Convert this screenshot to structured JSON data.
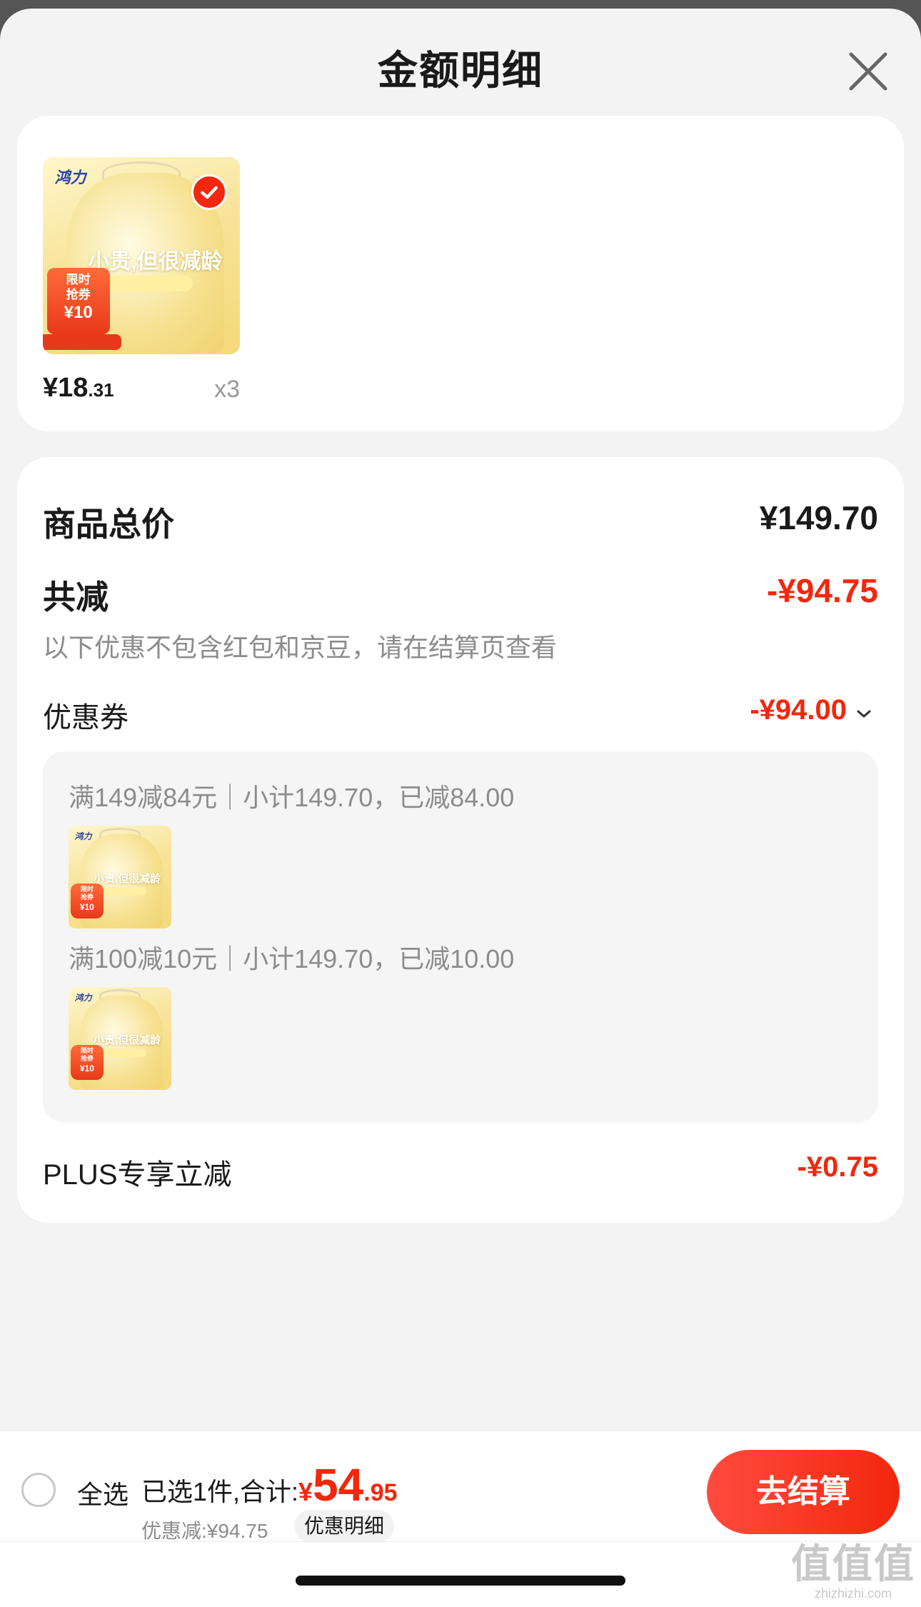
{
  "header": {
    "title": "金额明细"
  },
  "product": {
    "thumb_logo": "鸿力",
    "thumb_slogan": "小贵,但很减龄",
    "thumb_promo_line1": "限时",
    "thumb_promo_line2": "抢券",
    "thumb_promo_amount": "¥10",
    "price_int": "¥18",
    "price_dec": ".31",
    "quantity": "x3",
    "selected": true
  },
  "detail": {
    "total_label": "商品总价",
    "total_value": "¥149.70",
    "reduce_label": "共减",
    "reduce_value": "-¥94.75",
    "note": "以下优惠不包含红包和京豆，请在结算页查看",
    "coupon_label": "优惠券",
    "coupon_value": "-¥94.00",
    "coupons": [
      {
        "text": "满149减84元｜小计149.70，已减84.00"
      },
      {
        "text": "满100减10元｜小计149.70，已减10.00"
      }
    ],
    "plus_label": "PLUS专享立减",
    "plus_value": "-¥0.75"
  },
  "bottom": {
    "select_all_label": "全选",
    "selected_text": "已选1件,合计:",
    "total_yen": "¥",
    "total_int": "54",
    "total_dec": ".95",
    "discount_text": "优惠减:¥94.75",
    "detail_chip": "优惠明细",
    "checkout_label": "去结算"
  },
  "watermark": {
    "main": "值值值",
    "sub": "zhizhizhi.com"
  },
  "colors": {
    "accent": "#f2270c",
    "muted": "#8c8c8c",
    "background": "#f3f3f3"
  }
}
